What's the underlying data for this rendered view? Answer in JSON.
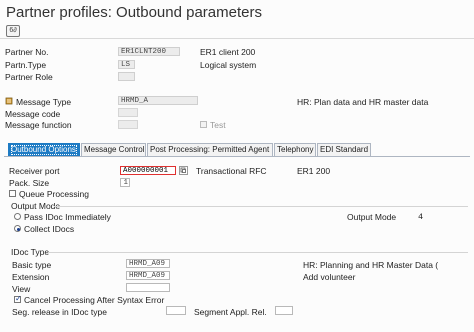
{
  "title": "Partner profiles: Outbound parameters",
  "toolbar": {
    "other_icon_glyph": "6∂"
  },
  "partner": {
    "no_label": "Partner No.",
    "no_value": "ER1CLNT200",
    "no_desc": "ER1 client 200",
    "type_label": "Partn.Type",
    "type_value": "LS",
    "type_desc": "Logical system",
    "role_label": "Partner Role",
    "role_value": ""
  },
  "message": {
    "type_label": "Message Type",
    "type_value": "HRMD_A",
    "type_desc": "HR: Plan data and HR master data",
    "code_label": "Message code",
    "function_label": "Message function",
    "test_label": "Test"
  },
  "tabs": [
    {
      "label": "Outbound Options"
    },
    {
      "label": "Message Control"
    },
    {
      "label": "Post Processing: Permitted Agent"
    },
    {
      "label": "Telephony"
    },
    {
      "label": "EDI Standard"
    }
  ],
  "outbound": {
    "receiver_port_label": "Receiver port",
    "receiver_port_value": "A000000001",
    "port_type": "Transactional RFC",
    "port_desc": "ER1 200",
    "pack_size_label": "Pack. Size",
    "pack_size_value": "1",
    "queue_processing_label": "Queue Processing",
    "output_mode_title": "Output Mode",
    "pass_idoc_label": "Pass IDoc Immediately",
    "collect_idocs_label": "Collect IDocs",
    "output_mode_label": "Output Mode",
    "output_mode_value": "4",
    "idoc_type_title": "IDoc Type",
    "basic_type_label": "Basic type",
    "basic_type_value": "HRMD_A09",
    "basic_type_desc": "HR: Planning and HR Master Data (",
    "extension_label": "Extension",
    "extension_value": "HRMD_A09",
    "extension_desc": "Add volunteer",
    "view_label": "View",
    "view_value": "",
    "cancel_label": "Cancel Processing After Syntax Error",
    "seg_release_label": "Seg. release in IDoc type",
    "segment_appl_label": "Segment Appl. Rel."
  }
}
